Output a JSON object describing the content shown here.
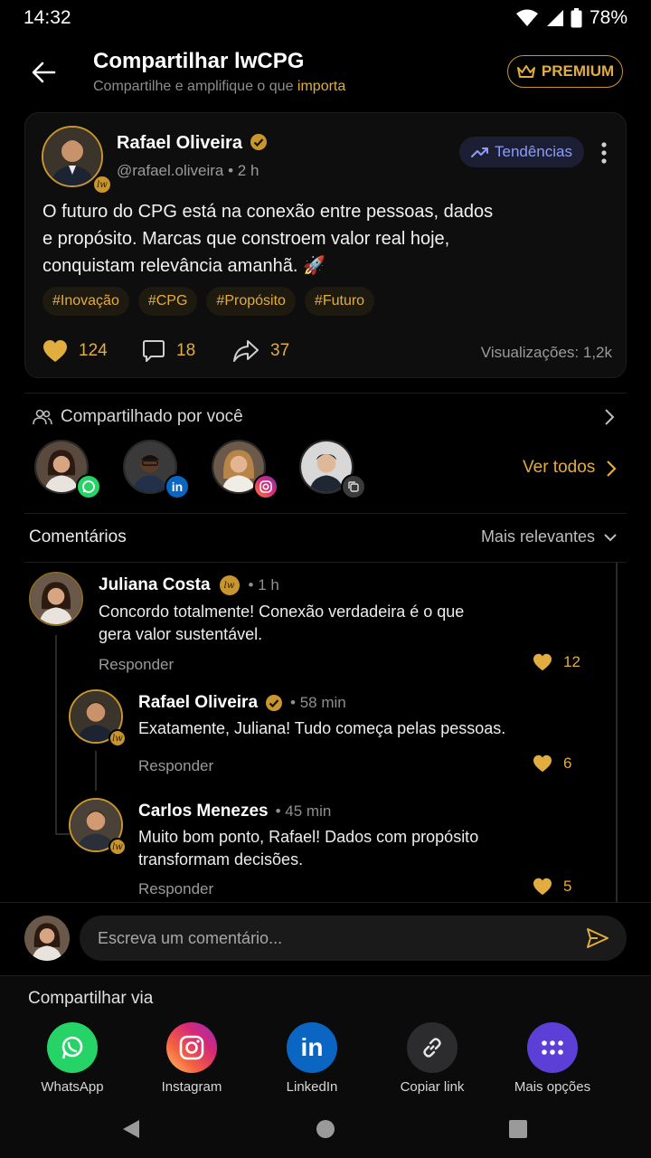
{
  "status_bar": {
    "time": "14:32",
    "battery": "78%"
  },
  "header": {
    "title": "Compartilhar lwCPG",
    "subtitle_prefix": "Compartilhe e amplifique o que ",
    "subtitle_accent": "importa",
    "premium_label": "PREMIUM"
  },
  "post": {
    "author": "Rafael Oliveira",
    "handle": "@rafael.oliveira",
    "time": "• 2 h",
    "badge": "lw",
    "trend_label": "Tendências",
    "text_lines": [
      "O futuro do CPG está na conexão entre pessoas, dados",
      "e propósito. Marcas que constroem valor real hoje,",
      "conquistam relevância amanhã. 🚀"
    ],
    "tags": [
      "#Inovação",
      "#CPG",
      "#Propósito",
      "#Futuro"
    ],
    "likes": "124",
    "comments": "18",
    "shares": "37",
    "views": "Visualizações: 1,2k"
  },
  "shared_by": {
    "title": "Compartilhado por você",
    "see_all": "Ver todos",
    "people": [
      {
        "channel": "whatsapp-icon",
        "color": "#25d366"
      },
      {
        "channel": "linkedin-icon",
        "color": "#0a66c2"
      },
      {
        "channel": "instagram-icon",
        "color": "#e1306c"
      },
      {
        "channel": "copy-icon",
        "color": "#3a3a3a"
      }
    ]
  },
  "comments": {
    "title": "Comentários",
    "sort": "Mais relevantes",
    "reply_label": "Responder",
    "items": [
      {
        "name": "Juliana Costa",
        "time": "• 1 h",
        "text1": "Concordo totalmente! Conexão verdadeira é o que",
        "text2": "gera valor sustentável.",
        "likes": "12"
      },
      {
        "name": "Rafael Oliveira",
        "time": "• 58 min",
        "text1": "Exatamente, Juliana! Tudo começa pelas pessoas.",
        "text2": "",
        "likes": "6"
      },
      {
        "name": "Carlos Menezes",
        "time": "• 45 min",
        "text1": "Muito bom ponto, Rafael! Dados com propósito",
        "text2": "transformam decisões.",
        "likes": "5"
      }
    ]
  },
  "comment_input": {
    "placeholder": "Escreva um comentário..."
  },
  "share_via": {
    "title": "Compartilhar via",
    "apps": [
      {
        "label": "WhatsApp",
        "color": "#25d366"
      },
      {
        "label": "Instagram",
        "color": "#d62976"
      },
      {
        "label": "LinkedIn",
        "color": "#0a66c2"
      },
      {
        "label": "Copiar link",
        "color": "#2c2c2e"
      },
      {
        "label": "Mais opções",
        "color": "#5b3fd6"
      }
    ]
  }
}
